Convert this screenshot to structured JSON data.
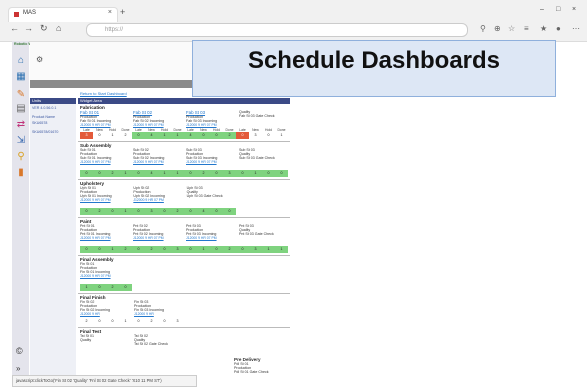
{
  "browser": {
    "tab_title": "MAS",
    "url": "https://",
    "new_tab_glyph": "+"
  },
  "logo_text": "Robotic Wiring Manufacturing",
  "breadcrumb": "Return to Start Dashboard",
  "left_panel": {
    "header": "Units",
    "version": "VER 4.0.56.0.1",
    "product_label": "Product Name",
    "product_value": "SKU6578",
    "order_label": "SKU6578/01670"
  },
  "main": {
    "header": "Widget Area",
    "sections": [
      {
        "title": "Fabrication",
        "cards": [
          {
            "link": "Fab St 01",
            "line1": "Production",
            "line2": "Fab St 01 Incoming",
            "sub": "J12000 9 HR 07 PM"
          },
          {
            "link": "Fab St 02",
            "line1": "Production",
            "line2": "Fab St 02 Incoming",
            "sub": "J12000 9 HR 07 PM"
          },
          {
            "link": "Fab St 03",
            "line1": "Production",
            "line2": "Fab St 03 Incoming",
            "sub": "J12000 9 HR 07 PM"
          },
          {
            "link": "",
            "line1": "Quality",
            "line2": "Fab St 03 Gate Check",
            "sub": ""
          }
        ]
      },
      {
        "title": "Sub Assembly",
        "cards": [
          {
            "link": "Sub St 01",
            "line1": "Production",
            "line2": "Sub St 01 Incoming",
            "sub": "J12000 9 HR 07 PM"
          },
          {
            "link": "Sub St 02",
            "line1": "Production",
            "line2": "Sub St 02 Incoming",
            "sub": "J12000 9 HR 07 PM"
          },
          {
            "link": "Sub St 03",
            "line1": "Production",
            "line2": "Sub St 03 Incoming",
            "sub": "J12000 9 HR 07 PM"
          },
          {
            "link": "Sub St 03",
            "line1": "Quality",
            "line2": "Sub St 03 Gate Check",
            "sub": ""
          }
        ]
      },
      {
        "title": "Upholstery",
        "cards": [
          {
            "link": "Uph St 01",
            "line1": "Production",
            "line2": "Uph St 01 Incoming",
            "sub": "J12000 9 HR 07 PM"
          },
          {
            "link": "Uph St 02",
            "line1": "Production",
            "line2": "Uph St 02 Incoming",
            "sub": "J12000 9 HR 07 PM"
          },
          {
            "link": "Uph St 03",
            "line1": "Quality",
            "line2": "Uph St 03 Gate Check",
            "sub": ""
          }
        ]
      },
      {
        "title": "Paint",
        "cards": [
          {
            "link": "Pnt St 01",
            "line1": "Production",
            "line2": "Pnt St 01 Incoming",
            "sub": "J12000 9 HR 07 PM"
          },
          {
            "link": "Pnt St 02",
            "line1": "Production",
            "line2": "Pnt St 02 Incoming",
            "sub": "J12000 9 HR 07 PM"
          },
          {
            "link": "Pnt St 03",
            "line1": "Production",
            "line2": "Pnt St 03 Incoming",
            "sub": "J12000 9 HR 07 PM"
          },
          {
            "link": "Pnt St 03",
            "line1": "Quality",
            "line2": "Pnt St 03 Gate Check",
            "sub": ""
          }
        ]
      },
      {
        "title": "Final Assembly",
        "cards": [
          {
            "link": "Fin St 01",
            "line1": "Production",
            "line2": "Fin St 01 Incoming",
            "sub": "J12000 9 HR 07 PM"
          }
        ]
      },
      {
        "title": "Final Finish",
        "cards": [
          {
            "link": "Fin St 02",
            "line1": "Production",
            "line2": "Fin St 02 Incoming",
            "sub": "J12000 9 HR"
          },
          {
            "link": "Fin St 03",
            "line1": "Production",
            "line2": "Fin St 03 Incoming",
            "sub": "J12000 9 HR"
          }
        ]
      },
      {
        "title": "Final Test",
        "cards": [
          {
            "link": "Tst St 01",
            "line1": "Quality",
            "line2": "",
            "sub": ""
          },
          {
            "link": "Tst St 02",
            "line1": "Quality",
            "line2": "Tst St 02 Gate Check",
            "sub": ""
          }
        ]
      }
    ],
    "stat_labels": [
      "Late",
      "New",
      "Hold",
      "Done"
    ],
    "fab_values": [
      "3",
      "0",
      "1",
      "2",
      "0",
      "4",
      "1",
      "1",
      "4",
      "0",
      "0",
      "2",
      "0",
      "3",
      "0",
      "1"
    ],
    "sub_values": [
      "0",
      "0",
      "2",
      "1",
      "0",
      "4",
      "1",
      "1",
      "0",
      "2",
      "0",
      "3",
      "0",
      "1",
      "0",
      "0"
    ],
    "uph_values": [
      "0",
      "2",
      "0",
      "1",
      "0",
      "3",
      "0",
      "2",
      "0",
      "4",
      "0",
      "0"
    ],
    "pnt_values": [
      "0",
      "0",
      "1",
      "2",
      "0",
      "2",
      "0",
      "3",
      "0",
      "1",
      "0",
      "2",
      "0",
      "3",
      "1",
      "1"
    ],
    "fa_values": [
      "1",
      "0",
      "2",
      "0"
    ],
    "ff_values": [
      "2",
      "0",
      "0",
      "1",
      "0",
      "2",
      "0",
      "3"
    ]
  },
  "pre_delivery": {
    "title": "Pre Delivery",
    "link": "Pdl St 01",
    "line1": "Production",
    "line2": "Pdl St 01 Gate Check"
  },
  "banner_title": "Schedule Dashboards",
  "status_url": "javascript:clickToGo('Fin St 02 'Quality' 'Fnl St 02 Gate Check' 'X10 11 PM ST')",
  "colors": {
    "accent": "#3b4a86",
    "good": "#7fd37f",
    "alert": "#e35a3a",
    "link": "#2277cc"
  }
}
